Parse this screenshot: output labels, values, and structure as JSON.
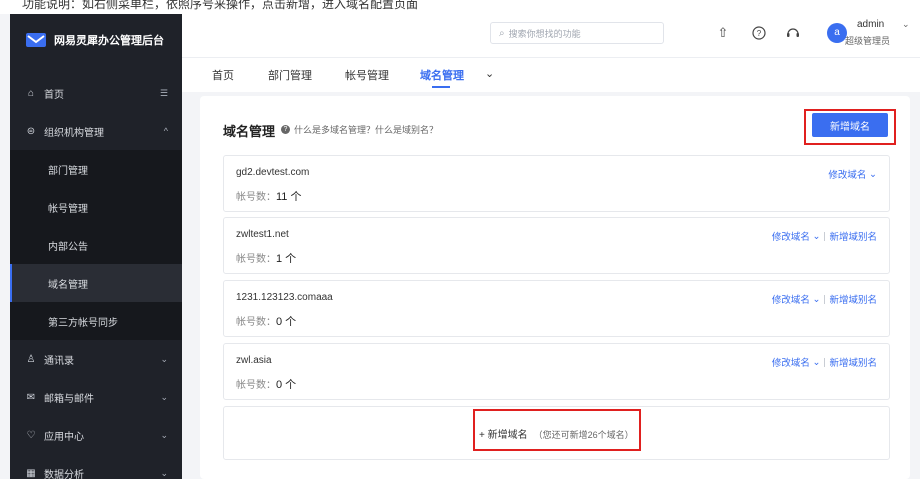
{
  "top_strip": {
    "text": "功能说明：如右侧菜单栏，依照序号来操作，点击新增，进入域名配置页面"
  },
  "sidebar": {
    "brand_title": "网易灵犀办公管理后台",
    "items": [
      {
        "label": "首页",
        "icon": "home-icon",
        "glyph": "⌂",
        "trailing": "☰"
      },
      {
        "label": "组织机构管理",
        "icon": "org-icon",
        "glyph": "⊜",
        "trailing": "^"
      },
      {
        "label": "通讯录",
        "icon": "contacts-icon",
        "glyph": "♙",
        "trailing": "⌄"
      },
      {
        "label": "邮箱与邮件",
        "icon": "mail-icon",
        "glyph": "✉",
        "trailing": "⌄"
      },
      {
        "label": "应用中心",
        "icon": "apps-icon",
        "glyph": "♡",
        "trailing": "⌄"
      },
      {
        "label": "数据分析",
        "icon": "chart-icon",
        "glyph": "▦",
        "trailing": "⌄"
      }
    ],
    "sub_items": [
      {
        "label": "部门管理"
      },
      {
        "label": "帐号管理"
      },
      {
        "label": "内部公告"
      },
      {
        "label": "域名管理",
        "active": true
      },
      {
        "label": "第三方帐号同步"
      }
    ]
  },
  "header": {
    "search_placeholder": "搜索你想找的功能",
    "icons": [
      "upload-icon",
      "help-icon",
      "support-icon"
    ],
    "user": {
      "avatar_letter": "a",
      "name": "admin",
      "role": "超级管理员"
    }
  },
  "tabs": [
    {
      "label": "首页"
    },
    {
      "label": "部门管理"
    },
    {
      "label": "帐号管理"
    },
    {
      "label": "域名管理",
      "active": true
    }
  ],
  "main": {
    "title": "域名管理",
    "help_text": "什么是多域名管理？什么是域别名？",
    "add_button": "新增域名",
    "count_label": "帐号数：",
    "modify_label": "修改域名",
    "add_alias_label": "新增域别名",
    "domains": [
      {
        "name": "gd2.devtest.com",
        "count": "11 个",
        "has_alias": false
      },
      {
        "name": "zwltest1.net",
        "count": "1 个",
        "has_alias": true
      },
      {
        "name": "1231.123123.comaaa",
        "count": "0 个",
        "has_alias": true
      },
      {
        "name": "zwl.asia",
        "count": "0 个",
        "has_alias": true
      }
    ],
    "add_domain_label": "+ 新增域名",
    "add_domain_note": "（您还可新增26个域名）"
  },
  "colors": {
    "accent": "#3a6ef0",
    "highlight": "#e0201f",
    "sidebar_bg": "#1f2229"
  }
}
